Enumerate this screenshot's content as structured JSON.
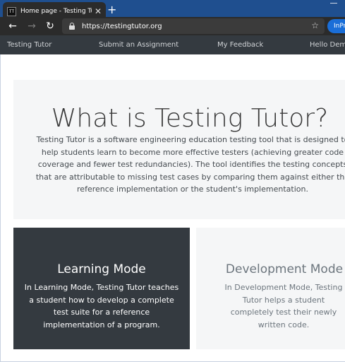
{
  "browser": {
    "favicon_text": "TT",
    "tab_title": "Home page - Testing Tutor",
    "url": "https://testingtutor.org",
    "inprivate_label": "InPrivate"
  },
  "nav": {
    "brand": "Testing Tutor",
    "submit": "Submit an Assignment",
    "feedback": "My Feedback",
    "hello": "Hello Demo!"
  },
  "hero": {
    "title": "What is Testing Tutor?",
    "text": "Testing Tutor is a software engineering education testing tool that is designed to help students learn to become more effective testers (achieving greater code coverage and fewer test redundancies). The tool identifies the testing concepts that are attributable to missing test cases by comparing them against either the reference implementation or the student's implementation."
  },
  "cards": {
    "learning": {
      "title": "Learning Mode",
      "text": "In Learning Mode, Testing Tutor teaches a student how to develop a complete test suite for a reference implementation of a program."
    },
    "development": {
      "title": "Development Mode",
      "text": "In Development Mode, Testing Tutor helps a student completely test their newly written code."
    }
  },
  "colors": {
    "tabbar": "#1f4f8f",
    "navbar": "#343a40",
    "hero_bg": "#f5f6f7",
    "accent": "#1a6ed8"
  }
}
